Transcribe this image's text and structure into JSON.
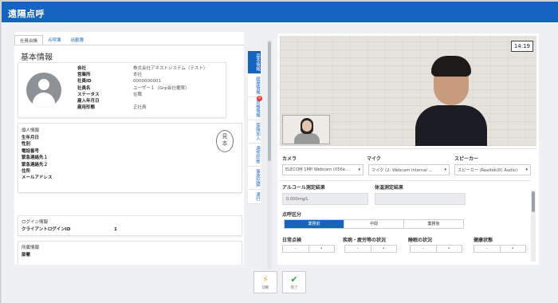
{
  "titlebar": {
    "title": "遠隔点呼"
  },
  "tabs": [
    {
      "label": "社員台帳"
    },
    {
      "label": "点呼簿"
    },
    {
      "label": "出勤簿"
    }
  ],
  "basic_info": {
    "title": "基本情報",
    "fields": [
      {
        "key": "会社",
        "value": "株式会社アネストシステム（テスト）"
      },
      {
        "key": "営業所",
        "value": "本社"
      },
      {
        "key": "社員ID",
        "value": "0000000001"
      },
      {
        "key": "社員名",
        "value": "ユーザー１（Grp会社権限）"
      },
      {
        "key": "ステータス",
        "value": "在職"
      },
      {
        "key": "雇入年月日",
        "value": ""
      },
      {
        "key": "雇用形態",
        "value": "正社員"
      }
    ]
  },
  "personal_info": {
    "title": "個人情報",
    "items": [
      "生年月日",
      "性別",
      "電話番号",
      "緊急連絡先１",
      "緊急連絡先２",
      "住所",
      "メールアドレス"
    ],
    "stamp": "見本"
  },
  "login_info": {
    "title": "ログイン情報",
    "client_login_label": "クライアントログインID",
    "client_login_value": "1"
  },
  "affiliation": {
    "title": "所属情報",
    "first_item": "部署"
  },
  "vtabs": [
    {
      "label": "基本情報",
      "badge": ""
    },
    {
      "label": "経歴情報",
      "badge": ""
    },
    {
      "label": "資格情報",
      "badge": "8"
    },
    {
      "label": "保険加入",
      "badge": ""
    },
    {
      "label": "適性診断",
      "badge": ""
    },
    {
      "label": "事故記録",
      "badge": ""
    },
    {
      "label": "運行",
      "badge": ""
    }
  ],
  "video": {
    "time": "14:19"
  },
  "devices": {
    "camera_label": "カメラ",
    "camera_value": "ELECOM 1MP Webcam (056e...",
    "mic_label": "マイク",
    "mic_value": "マイク (2- Webcam internal ...",
    "speaker_label": "スピーカー",
    "speaker_value": "スピーカー (Realtek(R) Audio)"
  },
  "measure": {
    "alcohol_label": "アルコール測定結果",
    "alcohol_value": "0.000mg/L",
    "temp_label": "体温測定結果",
    "temp_value": ""
  },
  "rollcall": {
    "label": "点呼区分",
    "options": [
      "業務前",
      "中間",
      "業務後"
    ],
    "selected_index": 0
  },
  "checks": [
    {
      "label": "日常点検"
    },
    {
      "label": "疾病・疲労等の状況"
    },
    {
      "label": "睡眠の状況"
    },
    {
      "label": "健康状態"
    }
  ],
  "buttons": {
    "cancel_label": "切断",
    "done_label": "完了"
  }
}
